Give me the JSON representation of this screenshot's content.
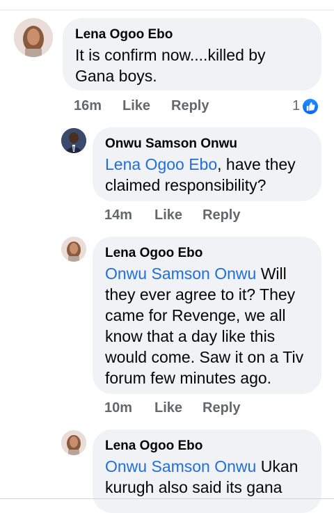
{
  "comments": [
    {
      "author": "Lena Ogoo Ebo",
      "text": "It is confirm now....killed by Gana boys.",
      "time": "16m",
      "like_label": "Like",
      "reply_label": "Reply",
      "reaction_count": "1"
    },
    {
      "author": "Onwu Samson Onwu",
      "mention": "Lena Ogoo Ebo",
      "text": ", have they claimed responsibility?",
      "time": "14m",
      "like_label": "Like",
      "reply_label": "Reply"
    },
    {
      "author": "Lena Ogoo Ebo",
      "mention": "Onwu Samson Onwu",
      "text": " Will they ever agree to it? They came for Revenge, we all know that a day like this would come. Saw it on a Tiv forum few minutes ago.",
      "time": "10m",
      "like_label": "Like",
      "reply_label": "Reply"
    },
    {
      "author": "Lena Ogoo Ebo",
      "mention": "Onwu Samson Onwu",
      "text": " Ukan kurugh also said its gana"
    }
  ],
  "colors": {
    "bubble": "#f0f2f5",
    "mention": "#216fdb",
    "meta": "#65676b",
    "like": "#0866ff"
  },
  "icons": {
    "avatar_lena": "woman-profile-photo",
    "avatar_onwu": "man-in-suit-profile-photo",
    "reaction": "thumbs-up-icon"
  }
}
